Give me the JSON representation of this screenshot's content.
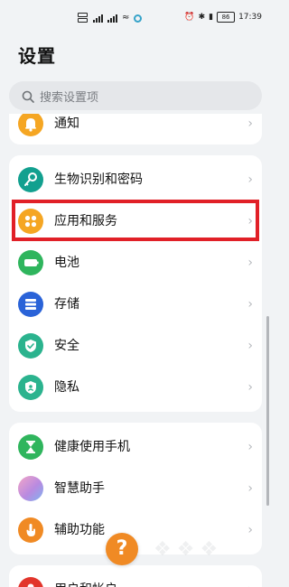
{
  "status_bar": {
    "time": "17:39",
    "battery": "86"
  },
  "page": {
    "title": "设置"
  },
  "search": {
    "placeholder": "搜索设置项"
  },
  "groups": [
    {
      "items": [
        {
          "label": "通知",
          "icon": "bell-icon",
          "color": "#f5a623"
        }
      ]
    },
    {
      "items": [
        {
          "label": "生物识别和密码",
          "icon": "key-icon",
          "color": "#12a08f"
        },
        {
          "label": "应用和服务",
          "icon": "apps-grid-icon",
          "color": "#f5a623",
          "highlighted": true
        },
        {
          "label": "电池",
          "icon": "battery-icon",
          "color": "#2fb55d"
        },
        {
          "label": "存储",
          "icon": "storage-icon",
          "color": "#2a63d8"
        },
        {
          "label": "安全",
          "icon": "shield-check-icon",
          "color": "#2bb38e"
        },
        {
          "label": "隐私",
          "icon": "privacy-shield-icon",
          "color": "#2bb38e"
        }
      ]
    },
    {
      "items": [
        {
          "label": "健康使用手机",
          "icon": "hourglass-icon",
          "color": "#2fb55d"
        },
        {
          "label": "智慧助手",
          "icon": "smart-assistant-icon",
          "color": "#b98ae0"
        },
        {
          "label": "辅助功能",
          "icon": "hand-icon",
          "color": "#f08a24"
        }
      ]
    },
    {
      "items": [
        {
          "label": "用户和帐户",
          "icon": "user-icon",
          "color": "#e2352b"
        }
      ]
    }
  ],
  "help_button": {
    "label": "?",
    "color": "#f08a24"
  },
  "highlight_color": "#e12027"
}
